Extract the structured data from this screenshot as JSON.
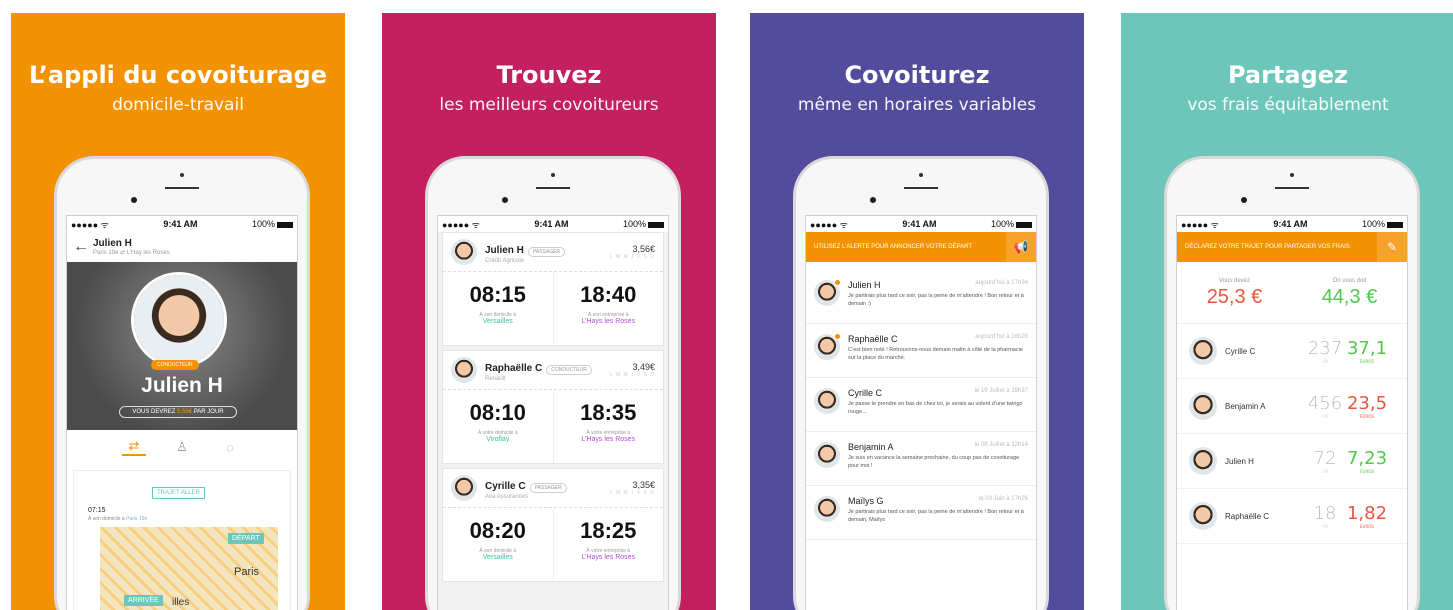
{
  "panels": [
    {
      "title": "L’appli du covoiturage",
      "subtitle": "domicile-travail",
      "color": "#F39200"
    },
    {
      "title": "Trouvez",
      "subtitle": "les meilleurs covoitureurs",
      "color": "#C2205E"
    },
    {
      "title": "Covoiturez",
      "subtitle": "même en horaires variables",
      "color": "#534C9D"
    },
    {
      "title": "Partagez",
      "subtitle": "vos frais équitablement",
      "color": "#6CC7BA"
    }
  ],
  "status": {
    "carrier": "●●●●● ᯤ",
    "time": "9:41 AM",
    "battery": "100%"
  },
  "profile": {
    "name": "Julien H",
    "route": "Paris 19e ⇄ L’Hay les Roses",
    "badge": "CONDUCTEUR",
    "big_name": "Julien H",
    "owe_prefix": "VOUS DEVREZ",
    "owe_amount": "5,56€",
    "owe_suffix": "PAR JOUR",
    "tab_icons": [
      "route-icon",
      "user-icon",
      "chat-icon"
    ],
    "trajet": "TRAJET ALLER",
    "time": "07:15",
    "home_prefix": "À son domicile à",
    "home_city": "Paris 19e",
    "map_depart": "DÉPART",
    "map_arrivee": "ARRIVÉE",
    "map_paris": "Paris",
    "map_city": "illes"
  },
  "rides": [
    {
      "name": "Julien H",
      "tag": "PASSAGER",
      "company": "Crédit Agricole",
      "price": "3,56€",
      "days": "L M M J V S D",
      "dep": "08:15",
      "dep_label": "À son domicile à",
      "dep_place": "Versailles",
      "arr": "18:40",
      "arr_label": "À son entreprise à",
      "arr_place": "L’Hays les Roses"
    },
    {
      "name": "Raphaëlle C",
      "tag": "CONDUCTEUR",
      "company": "Renault",
      "price": "3,49€",
      "days": "L M M J V S D",
      "dep": "08:10",
      "dep_label": "À votre domicile à",
      "dep_place": "Viroflay",
      "arr": "18:35",
      "arr_label": "À votre entreprise à",
      "arr_place": "L’Hays les Roses"
    },
    {
      "name": "Cyrille C",
      "tag": "PASSAGER",
      "company": "Axa Assurances",
      "price": "3,35€",
      "days": "L M M J V S D",
      "dep": "08:20",
      "dep_label": "À son domicile à",
      "dep_place": "Versailles",
      "arr": "18:25",
      "arr_label": "À votre entreprise à",
      "arr_place": "L’Hays les Roses"
    }
  ],
  "alert": "UTILISEZ L’ALERTE POUR ANNONCER VOTRE DÉPART",
  "messages": [
    {
      "name": "Julien H",
      "date": "aujourd’hui à 17h34",
      "text": "Je partirais plus tard ce soir, pas la peine de m’attendre ! Bon retour et à demain :)",
      "unread": true
    },
    {
      "name": "Raphaëlle C",
      "date": "aujourd’hui à 16h28",
      "text": "C’est bien noté ! Retrouvons-nous demain matin à côté de la pharmacie sur la place du marché.",
      "unread": true
    },
    {
      "name": "Cyrille C",
      "date": "le 19 Juillet à 19h37",
      "text": "Je passe te prendre en bas de chez toi, je serais au volent d’une twingo rouge...",
      "unread": false
    },
    {
      "name": "Benjamin A",
      "date": "le 08 Juillet à 12h14",
      "text": "Je suis en vacance la semaine prochaine, du coup pas de covoiturage pour moi !",
      "unread": false
    },
    {
      "name": "Maïlys G",
      "date": "le 03 Juin à 17h26",
      "text": "Je partirais plus tard ce soir, pas la peine de m’attendre ! Bon retour et à demain, Maïlys",
      "unread": false
    }
  ],
  "expenses": {
    "alert": "DÉCLAREZ VOTRE TRAJET POUR PARTAGER VOS FRAIS",
    "owe_label": "Vous devez",
    "owe_value": "25,3 €",
    "due_label": "On vous doit",
    "due_value": "44,3 €",
    "km_unit": "KM",
    "eur_unit": "EUROS",
    "rows": [
      {
        "name": "Cyrille C",
        "km": "237",
        "euros": "37,1",
        "positive": true
      },
      {
        "name": "Benjamin A",
        "km": "456",
        "euros": "23,5",
        "positive": false
      },
      {
        "name": "Julien H",
        "km": "72",
        "euros": "7,23",
        "positive": true
      },
      {
        "name": "Raphaëlle C",
        "km": "18",
        "euros": "1,82",
        "positive": false
      }
    ]
  }
}
